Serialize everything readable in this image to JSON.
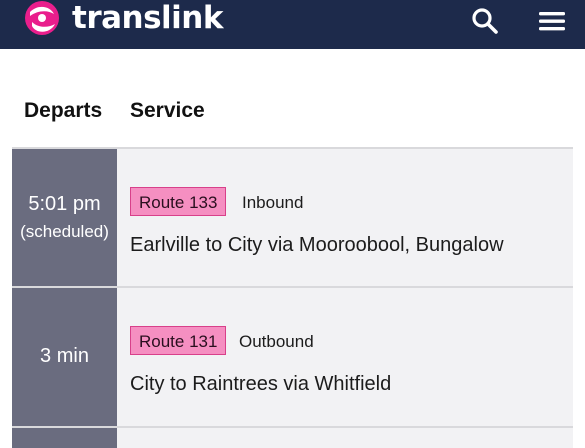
{
  "header": {
    "brand": "translink",
    "search_icon": "search-icon",
    "menu_icon": "hamburger-menu-icon",
    "background_color": "#1d2a4b",
    "brand_color": "#e91e8c"
  },
  "table": {
    "columns": [
      "Departs",
      "Service"
    ],
    "rows": [
      {
        "departs": "5:01 pm",
        "departs_note": "(scheduled)",
        "route": "Route 133",
        "direction": "Inbound",
        "description": "Earlville to City via Mooroobool, Bungalow"
      },
      {
        "departs": "3 min",
        "departs_note": "",
        "route": "Route 131",
        "direction": "Outbound",
        "description": "City to Raintrees via Whitfield"
      }
    ]
  },
  "colors": {
    "route_badge": "#f58fc1",
    "time_cell": "#6a6c7f",
    "row_background": "#f2f2f4"
  }
}
